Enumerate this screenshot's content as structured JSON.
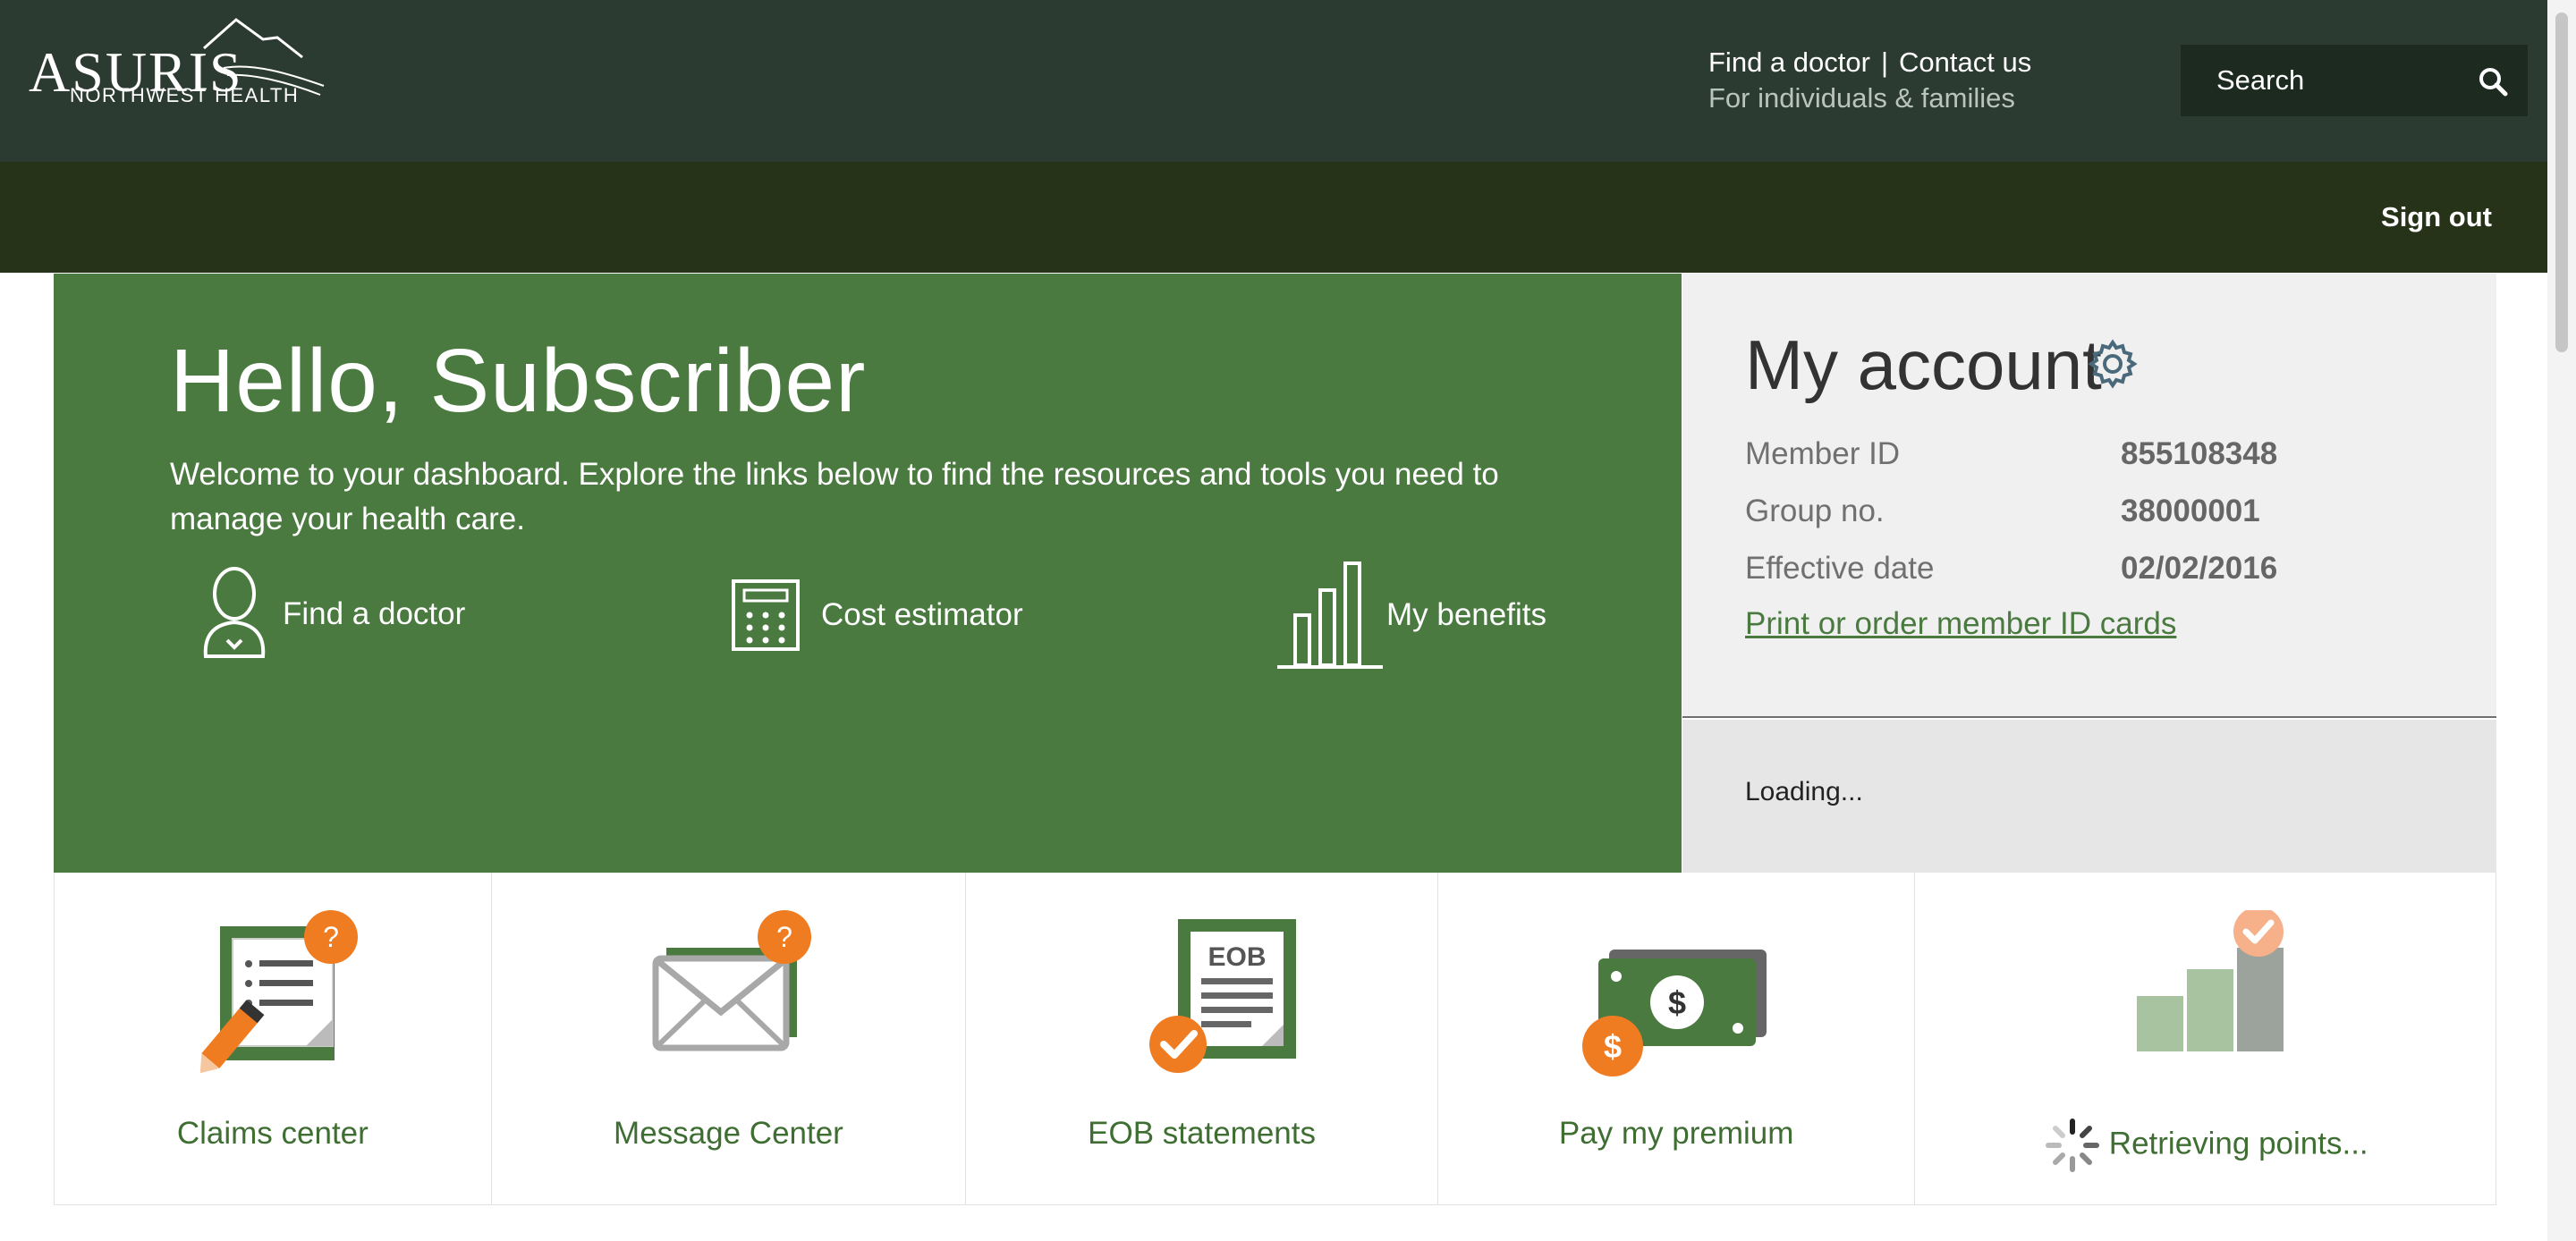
{
  "header": {
    "logo": {
      "name": "ASURIS",
      "sub": "NORTHWEST HEALTH"
    },
    "find_doctor": "Find a doctor",
    "divider": "|",
    "contact_us": "Contact us",
    "audience": "For individuals & families",
    "search_placeholder": "Search",
    "sign_out": "Sign out"
  },
  "hero": {
    "greeting": "Hello, Subscriber",
    "welcome": "Welcome to your dashboard. Explore the links below to find the resources and tools you need to manage your health care.",
    "links": [
      {
        "label": "Find a doctor",
        "icon": "person-icon"
      },
      {
        "label": "Cost estimator",
        "icon": "calculator-icon"
      },
      {
        "label": "My benefits",
        "icon": "bar-chart-icon"
      }
    ]
  },
  "account": {
    "title": "My account",
    "member_id_label": "Member ID",
    "member_id": "855108348",
    "group_label": "Group no.",
    "group_no": "38000001",
    "effective_label": "Effective date",
    "effective_date": "02/02/2016",
    "id_cards_link": "Print or order member ID cards",
    "loading": "Loading..."
  },
  "tiles": [
    {
      "label": "Claims center",
      "icon": "claims-icon"
    },
    {
      "label": "Message Center",
      "icon": "envelope-icon"
    },
    {
      "label": "EOB statements",
      "icon": "eob-document-icon",
      "icon_text": "EOB"
    },
    {
      "label": "Pay my premium",
      "icon": "money-icon"
    },
    {
      "label": "Retrieving points...",
      "icon": "points-chart-icon"
    }
  ],
  "colors": {
    "header": "#2c3b32",
    "nav_bar": "#263319",
    "hero_green": "#4b7a41",
    "accent_orange": "#f07c22",
    "tile_text": "#3f6e33"
  }
}
